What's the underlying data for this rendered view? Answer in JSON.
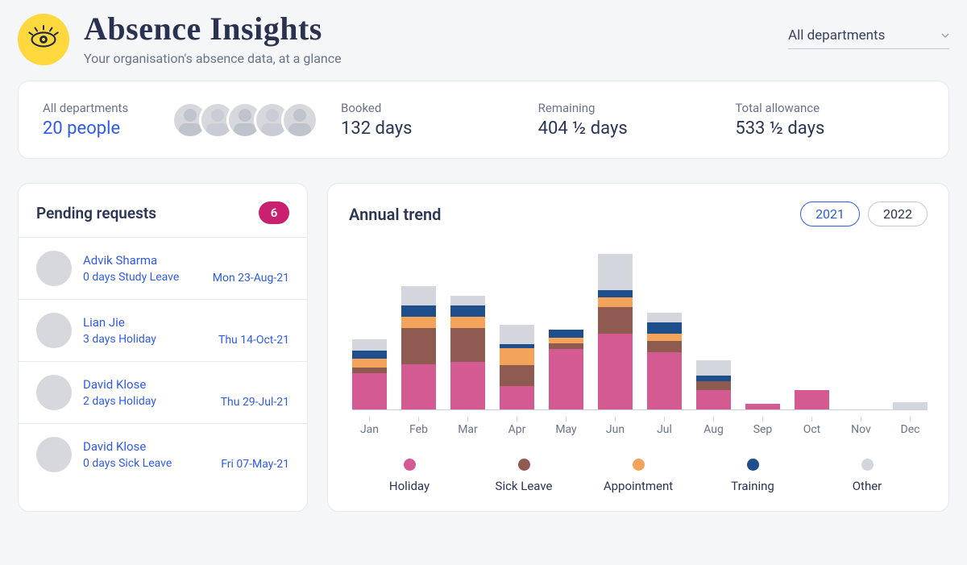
{
  "header": {
    "title": "Absence Insights",
    "subtitle": "Your organisation's absence data, at a glance",
    "dept_selector": {
      "value": "All departments"
    }
  },
  "summary": {
    "scope_label": "All departments",
    "people": "20 people",
    "booked": {
      "label": "Booked",
      "value": "132 days"
    },
    "remaining": {
      "label": "Remaining",
      "value": "404 ½ days"
    },
    "allowance": {
      "label": "Total allowance",
      "value": "533 ½ days"
    }
  },
  "pending": {
    "title": "Pending requests",
    "count": "6",
    "items": [
      {
        "name": "Advik Sharma",
        "meta": "0 days  Study Leave",
        "date": "Mon 23-Aug-21"
      },
      {
        "name": "Lian Jie",
        "meta": "3 days  Holiday",
        "date": "Thu 14-Oct-21"
      },
      {
        "name": "David Klose",
        "meta": "2 days  Holiday",
        "date": "Thu 29-Jul-21"
      },
      {
        "name": "David Klose",
        "meta": "0 days  Sick Leave",
        "date": "Fri 07-May-21"
      }
    ]
  },
  "trend": {
    "title": "Annual trend",
    "years": {
      "active": "2021",
      "other": "2022"
    }
  },
  "legend": {
    "holiday": "Holiday",
    "sick": "Sick Leave",
    "appoint": "Appointment",
    "training": "Training",
    "other": "Other"
  },
  "colors": {
    "holiday": "#d45b92",
    "sick": "#8f5a4f",
    "appoint": "#f4a45a",
    "training": "#1f4e8c",
    "other": "#d3d6dc"
  },
  "chart_data": {
    "type": "bar",
    "stack_order": [
      "holiday",
      "sick",
      "appoint",
      "training",
      "other"
    ],
    "categories": [
      "Jan",
      "Feb",
      "Mar",
      "Apr",
      "May",
      "Jun",
      "Jul",
      "Aug",
      "Sep",
      "Oct",
      "Nov",
      "Dec"
    ],
    "series": [
      {
        "name": "Holiday",
        "key": "holiday",
        "values": [
          38,
          48,
          50,
          25,
          64,
          80,
          60,
          20,
          6,
          20,
          0,
          0
        ]
      },
      {
        "name": "Sick Leave",
        "key": "sick",
        "values": [
          6,
          38,
          36,
          22,
          6,
          28,
          12,
          10,
          0,
          0,
          0,
          0
        ]
      },
      {
        "name": "Appointment",
        "key": "appoint",
        "values": [
          10,
          12,
          12,
          18,
          6,
          10,
          8,
          0,
          0,
          0,
          0,
          0
        ]
      },
      {
        "name": "Training",
        "key": "training",
        "values": [
          8,
          12,
          12,
          4,
          8,
          8,
          12,
          6,
          0,
          0,
          0,
          0
        ]
      },
      {
        "name": "Other",
        "key": "other",
        "values": [
          12,
          20,
          10,
          20,
          0,
          38,
          10,
          16,
          0,
          0,
          0,
          8
        ]
      }
    ],
    "title": "Annual trend",
    "xlabel": "",
    "ylabel": "",
    "ylim": [
      0,
      170
    ]
  }
}
